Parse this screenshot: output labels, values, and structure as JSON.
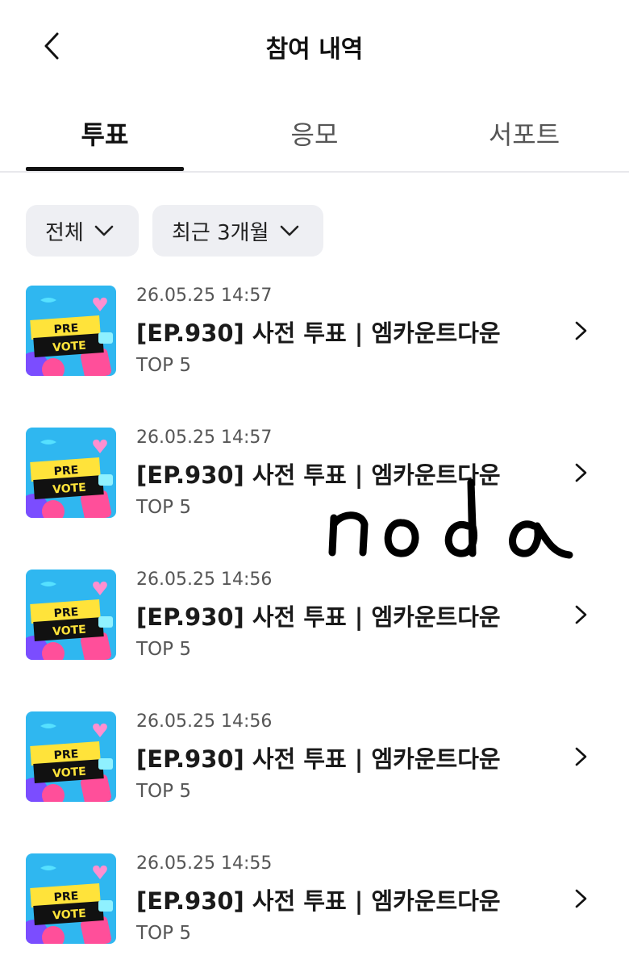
{
  "header": {
    "title": "참여 내역",
    "back_icon": "chevron-left-icon"
  },
  "tabs": [
    {
      "label": "투표",
      "active": true
    },
    {
      "label": "응모",
      "active": false
    },
    {
      "label": "서포트",
      "active": false
    }
  ],
  "filters": [
    {
      "label": "전체",
      "icon": "chevron-down-icon"
    },
    {
      "label": "최근 3개월",
      "icon": "chevron-down-icon"
    }
  ],
  "items": [
    {
      "date": "26.05.25 14:57",
      "title": "[EP.930] 사전 투표 | 엠카운트다운",
      "subtitle": "TOP 5",
      "thumb_top": "PRE",
      "thumb_bottom": "VOTE"
    },
    {
      "date": "26.05.25 14:57",
      "title": "[EP.930] 사전 투표 | 엠카운트다운",
      "subtitle": "TOP 5",
      "thumb_top": "PRE",
      "thumb_bottom": "VOTE"
    },
    {
      "date": "26.05.25 14:56",
      "title": "[EP.930] 사전 투표 | 엠카운트다운",
      "subtitle": "TOP 5",
      "thumb_top": "PRE",
      "thumb_bottom": "VOTE"
    },
    {
      "date": "26.05.25 14:56",
      "title": "[EP.930] 사전 투표 | 엠카운트다운",
      "subtitle": "TOP 5",
      "thumb_top": "PRE",
      "thumb_bottom": "VOTE"
    },
    {
      "date": "26.05.25 14:55",
      "title": "[EP.930] 사전 투표 | 엠카운트다운",
      "subtitle": "TOP 5",
      "thumb_top": "PRE",
      "thumb_bottom": "VOTE"
    }
  ],
  "overlay": {
    "handwriting": "noda"
  },
  "colors": {
    "thumb_bg": "#2fb7f0",
    "thumb_banner": "#ffe33a",
    "thumb_pink": "#ff4f9a",
    "thumb_purple": "#7b4dff",
    "tab_indicator": "#111111",
    "chip_bg": "#eeeff3"
  }
}
